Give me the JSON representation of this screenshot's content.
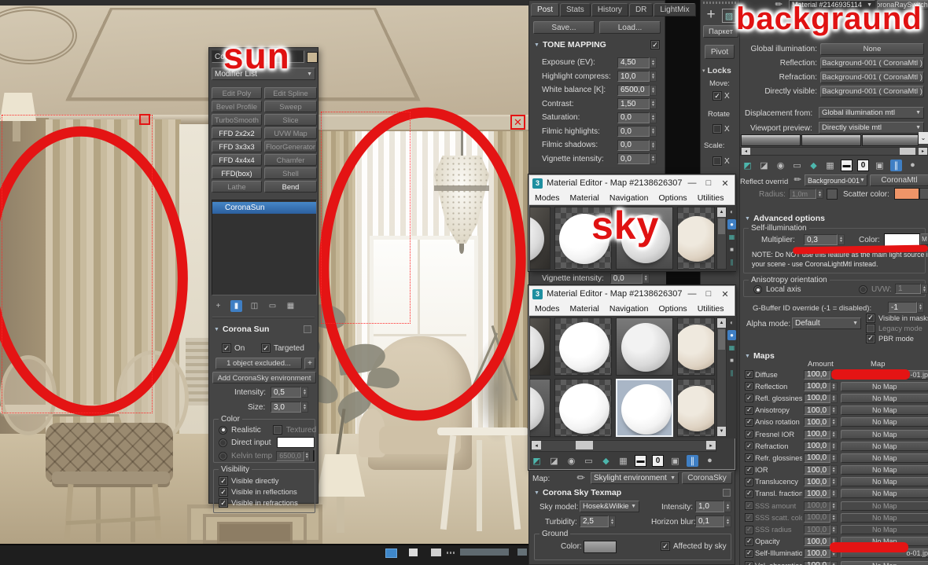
{
  "annotations": {
    "sun_label": "sun",
    "sky_label": "sky",
    "background_label": "backgraund",
    "red_color": "#e41414"
  },
  "modifier_panel": {
    "object_name": "Coro",
    "modifier_list_label": "Modifier List",
    "buttons": [
      {
        "label": "Edit Poly",
        "bright": false
      },
      {
        "label": "Edit Spline",
        "bright": false
      },
      {
        "label": "Bevel Profile",
        "bright": false
      },
      {
        "label": "Sweep",
        "bright": false
      },
      {
        "label": "TurboSmooth",
        "bright": false
      },
      {
        "label": "Slice",
        "bright": false
      },
      {
        "label": "FFD 2x2x2",
        "bright": true
      },
      {
        "label": "UVW Map",
        "bright": false
      },
      {
        "label": "FFD 3x3x3",
        "bright": true
      },
      {
        "label": "FloorGenerator",
        "bright": false
      },
      {
        "label": "FFD 4x4x4",
        "bright": true
      },
      {
        "label": "Chamfer",
        "bright": false
      },
      {
        "label": "FFD(box)",
        "bright": true
      },
      {
        "label": "Shell",
        "bright": false
      },
      {
        "label": "Lathe",
        "bright": false
      },
      {
        "label": "Bend",
        "bright": true
      }
    ],
    "stack_selected": "CoronaSun",
    "stack_icons": [
      {
        "name": "pin-stack-icon",
        "glyph": "+",
        "active": false
      },
      {
        "name": "show-end-result-icon",
        "glyph": "▮",
        "active": true
      },
      {
        "name": "make-unique-icon",
        "glyph": "◫",
        "active": false
      },
      {
        "name": "remove-modifier-icon",
        "glyph": "▭",
        "active": false
      },
      {
        "name": "configure-modifier-sets-icon",
        "glyph": "▦",
        "active": false
      }
    ],
    "rollout_title": "Corona Sun",
    "on_label": "On",
    "targeted_label": "Targeted",
    "exclude_button": "1 object excluded...",
    "plus_button": "+",
    "add_sky_button": "Add CoronaSky environment",
    "intensity_label": "Intensity:",
    "intensity_value": "0,5",
    "size_label": "Size:",
    "size_value": "3,0",
    "color_group": {
      "title": "Color",
      "realistic": "Realistic",
      "textured": "Textured",
      "direct_input": "Direct input",
      "kelvin_temp": "Kelvin temp",
      "kelvin_value": "6500,0"
    },
    "visibility_group": {
      "title": "Visibility",
      "items": [
        "Visible directly",
        "Visible in reflections",
        "Visible in refractions"
      ]
    }
  },
  "post_panel": {
    "tabs": [
      "Post",
      "Stats",
      "History",
      "DR",
      "LightMix"
    ],
    "save_button": "Save...",
    "load_button": "Load...",
    "rollout_title": "TONE MAPPING",
    "params": [
      {
        "label": "Exposure (EV):",
        "value": "4,50"
      },
      {
        "label": "Highlight compress:",
        "value": "10,0"
      },
      {
        "label": "White balance [K]:",
        "value": "6500,0"
      },
      {
        "label": "Contrast:",
        "value": "1,50"
      },
      {
        "label": "Saturation:",
        "value": "0,0"
      },
      {
        "label": "Filmic highlights:",
        "value": "0,0"
      },
      {
        "label": "Filmic shadows:",
        "value": "0,0"
      },
      {
        "label": "Vignette intensity:",
        "value": "0,0"
      }
    ],
    "sliver": {
      "label": "Vignette intensity:",
      "value": "0,0"
    }
  },
  "material_editor_1": {
    "title": "Material Editor - Map #2138626307",
    "menus": [
      "Modes",
      "Material",
      "Navigation",
      "Options",
      "Utilities"
    ],
    "slots": [
      "cut-dark",
      "white-checker",
      "gray-grad",
      "tan-checker"
    ]
  },
  "material_editor_2": {
    "title": "Material Editor - Map #2138626307",
    "menus": [
      "Modes",
      "Material",
      "Navigation",
      "Options",
      "Utilities"
    ],
    "rows": [
      [
        "cut-dark",
        "white-checker",
        "gray-grad",
        "tan-checker"
      ],
      [
        "cut-light",
        "white-checker",
        "white-selected",
        "tan-checker"
      ]
    ]
  },
  "editor_toolbar": [
    {
      "name": "get-material-icon",
      "glyph": "◩",
      "tone": "teal"
    },
    {
      "name": "put-to-library-icon",
      "glyph": "◪",
      "tone": "gray"
    },
    {
      "name": "assign-to-selection-icon",
      "glyph": "◉",
      "tone": "gray"
    },
    {
      "name": "delete-map-icon",
      "glyph": "▭",
      "tone": "gray"
    },
    {
      "name": "sample-type-icon",
      "glyph": "◆",
      "tone": "teal"
    },
    {
      "name": "make-preview-icon",
      "glyph": "▦",
      "tone": "gray"
    },
    {
      "name": "save-material-icon",
      "glyph": "▬",
      "tone": "boxed"
    },
    {
      "name": "zero-slot-icon",
      "glyph": "0",
      "tone": "boxed"
    },
    {
      "name": "options-icon",
      "glyph": "▣",
      "tone": "gray"
    },
    {
      "name": "show-end-result-icon",
      "glyph": "∥",
      "tone": "active"
    },
    {
      "name": "pick-material-icon",
      "glyph": "●",
      "tone": "gray"
    }
  ],
  "me_side_icons": [
    {
      "name": "sample-sphere-icon",
      "glyph": "◐",
      "tone": "gray"
    },
    {
      "name": "backlight-icon",
      "glyph": "●",
      "tone": "active"
    },
    {
      "name": "pattern-background-icon",
      "glyph": "▦",
      "tone": "teal"
    },
    {
      "name": "video-color-check-icon",
      "glyph": "■",
      "tone": "gray"
    },
    {
      "name": "options-bars-icon",
      "glyph": "∥",
      "tone": "teal"
    }
  ],
  "sky_panel": {
    "map_label": "Map:",
    "map_slot_value": "Skylight environment",
    "map_type_button": "CoronaSky",
    "rollout_title": "Corona Sky Texmap",
    "sky_model_label": "Sky model:",
    "sky_model_value": "Hosek&Wilkie",
    "intensity_label": "Intensity:",
    "intensity_value": "1,0",
    "turbidity_label": "Turbidity:",
    "turbidity_value": "2,5",
    "horizon_blur_label": "Horizon blur:",
    "horizon_blur_value": "0,1",
    "ground_title": "Ground",
    "ground_color_label": "Color:",
    "affected_label": "Affected by sky"
  },
  "command_strip": {
    "parket_button": "Паркет",
    "pivot_button": "Pivot",
    "locks_label": "Locks",
    "move_label": "Move:",
    "rotate_label": "Rotate",
    "scale_label": "Scale:",
    "x_label": "X"
  },
  "material_panel": {
    "header_name": "Material #2146935114",
    "header_type": "oronaRaySwitchl",
    "slots": [
      {
        "label": "Global illumination:",
        "value": "None"
      },
      {
        "label": "Reflection:",
        "value": "Background-001  ( CoronaMtl )"
      },
      {
        "label": "Refraction:",
        "value": "Background-001  ( CoronaMtl )"
      },
      {
        "label": "Directly visible:",
        "value": "Background-001  ( CoronaMtl )"
      }
    ],
    "displacement_label": "Displacement from:",
    "displacement_value": "Global illumination mtl",
    "viewport_preview_label": "Viewport preview:",
    "viewport_preview_value": "Directly visible mtl",
    "reflect_override_label": "Reflect overrid",
    "reflect_override_value": "Background-001",
    "reflect_override_type": "CoronaMtl",
    "radius_label": "Radius:",
    "radius_value": "1,0m",
    "scatter_label": "Scatter color:",
    "scatter_color": "#ef9568",
    "advanced": {
      "title": "Advanced options",
      "selfillum_title": "Self-illumination",
      "multiplier_label": "Multiplier:",
      "multiplier_value": "0,3",
      "color_label": "Color:",
      "m_button": "M",
      "note_line1": "NOTE: Do NOT use this feature as the main light source in",
      "note_line2": "your scene - use CoronaLightMtl instead.",
      "aniso_title": "Anisotropy orientation",
      "local_axis_label": "Local axis",
      "uvw_label": "UVW:",
      "uvw_value": "1",
      "gbuffer_label": "G-Buffer ID override (-1 = disabled):",
      "gbuffer_value": "-1",
      "alpha_label": "Alpha mode:",
      "alpha_value": "Default",
      "checks": [
        {
          "label": "Visible in masks",
          "state": "checked"
        },
        {
          "label": "Legacy mode",
          "state": "dim"
        },
        {
          "label": "PBR mode",
          "state": "checked"
        }
      ]
    },
    "maps": {
      "title": "Maps",
      "amount_header": "Amount",
      "map_header": "Map",
      "rows": [
        {
          "label": "Diffuse",
          "amount": "100,0",
          "map": "-01.jp",
          "redbar": true,
          "dim": false
        },
        {
          "label": "Reflection",
          "amount": "100,0",
          "map": "No Map",
          "redbar": false,
          "dim": false
        },
        {
          "label": "Refl. glossiness",
          "amount": "100,0",
          "map": "No Map",
          "redbar": false,
          "dim": false
        },
        {
          "label": "Anisotropy",
          "amount": "100,0",
          "map": "No Map",
          "redbar": false,
          "dim": false
        },
        {
          "label": "Aniso rotation",
          "amount": "100,0",
          "map": "No Map",
          "redbar": false,
          "dim": false
        },
        {
          "label": "Fresnel IOR",
          "amount": "100,0",
          "map": "No Map",
          "redbar": false,
          "dim": false
        },
        {
          "label": "Refraction",
          "amount": "100,0",
          "map": "No Map",
          "redbar": false,
          "dim": false
        },
        {
          "label": "Refr. glossiness",
          "amount": "100,0",
          "map": "No Map",
          "redbar": false,
          "dim": false
        },
        {
          "label": "IOR",
          "amount": "100,0",
          "map": "No Map",
          "redbar": false,
          "dim": false
        },
        {
          "label": "Translucency",
          "amount": "100,0",
          "map": "No Map",
          "redbar": false,
          "dim": false
        },
        {
          "label": "Transl. fraction",
          "amount": "100,0",
          "map": "No Map",
          "redbar": false,
          "dim": false
        },
        {
          "label": "SSS amount",
          "amount": "100,0",
          "map": "No Map",
          "redbar": false,
          "dim": true
        },
        {
          "label": "SSS scatt. color",
          "amount": "100,0",
          "map": "No Map",
          "redbar": false,
          "dim": true
        },
        {
          "label": "SSS radius",
          "amount": "100,0",
          "map": "No Map",
          "redbar": false,
          "dim": true
        },
        {
          "label": "Opacity",
          "amount": "100,0",
          "map": "No Map",
          "redbar": false,
          "dim": false
        },
        {
          "label": "Self-Illumination",
          "amount": "100,0",
          "map": "o-01.jp",
          "redbar": true,
          "dim": false
        },
        {
          "label": "Vol. absorption",
          "amount": "100,0",
          "map": "No Map",
          "redbar": false,
          "dim": false
        }
      ]
    }
  }
}
